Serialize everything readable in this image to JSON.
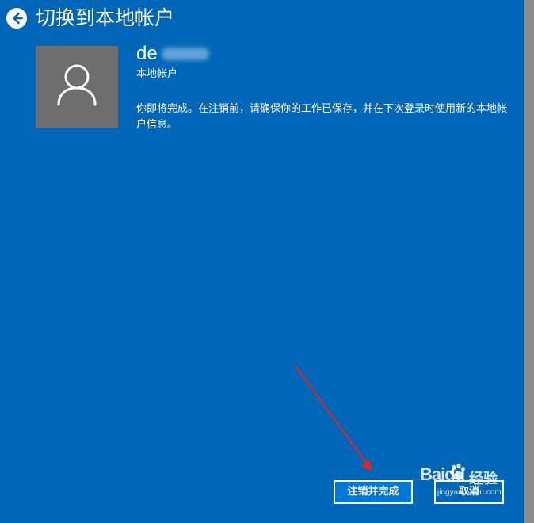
{
  "window": {
    "title": "切换到本地帐户",
    "background_color": "#0067b8"
  },
  "header": {
    "back_icon": "back-arrow-circle-icon"
  },
  "account": {
    "avatar_icon": "user-silhouette-icon",
    "name": "de",
    "type": "本地帐户",
    "message": "你即将完成。在注销前，请确保你的工作已保存，并在下次登录时使用新的本地帐户信息。"
  },
  "buttons": {
    "primary_label": "注销并完成",
    "cancel_label": "取消"
  },
  "annotation": {
    "arrow_color": "#e8221c"
  },
  "watermark": {
    "brand": "Baidu",
    "product": "经验",
    "url": "jingyan.baidu.com"
  }
}
